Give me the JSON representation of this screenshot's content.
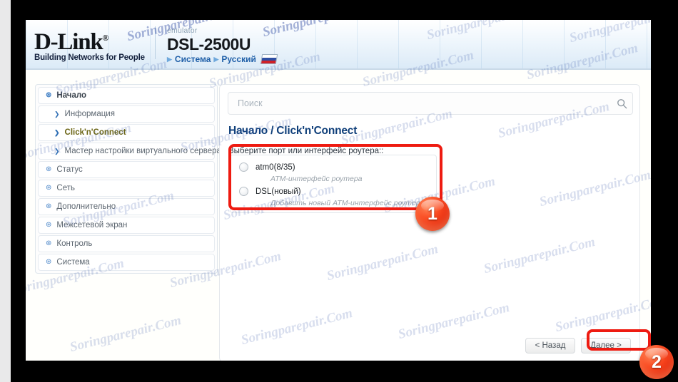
{
  "header": {
    "brand_name": "D-Link",
    "brand_reg": "®",
    "brand_tagline": "Building Networks for People",
    "emulator_label": "emulator",
    "model": "DSL-2500U",
    "link_system": "Система",
    "link_language": "Русский",
    "arrow": "▶",
    "flag": "ru-flag-icon"
  },
  "sidebar": {
    "items": [
      {
        "label": "Начало",
        "level": "top",
        "icon": "circle-collapse-icon",
        "active": false
      },
      {
        "label": "Информация",
        "level": "sub",
        "icon": "chevron-right-icon",
        "active": false
      },
      {
        "label": "Click'n'Connect",
        "level": "sub",
        "icon": "chevron-right-icon",
        "active": true
      },
      {
        "label": "Мастер настройки виртуального сервера",
        "level": "sub",
        "icon": "chevron-right-icon",
        "active": false
      },
      {
        "label": "Статус",
        "level": "top-nb",
        "icon": "circle-collapse-icon",
        "active": false
      },
      {
        "label": "Сеть",
        "level": "top-nb",
        "icon": "circle-collapse-icon",
        "active": false
      },
      {
        "label": "Дополнительно",
        "level": "top-nb",
        "icon": "circle-collapse-icon",
        "active": false
      },
      {
        "label": "Межсетевой экран",
        "level": "top-nb",
        "icon": "circle-collapse-icon",
        "active": false
      },
      {
        "label": "Контроль",
        "level": "top-nb",
        "icon": "circle-collapse-icon",
        "active": false
      },
      {
        "label": "Система",
        "level": "top-nb",
        "icon": "circle-collapse-icon",
        "active": false
      }
    ]
  },
  "main": {
    "search_placeholder": "Поиск",
    "search_value": "",
    "search_icon": "search-icon",
    "title": "Начало /  Click'n'Connect",
    "field_label": "Выберите порт или интерфейс роутера::",
    "radio_options": [
      {
        "label": "atm0(8/35)",
        "description": "ATM-интерфейс роутера",
        "selected": false
      },
      {
        "label": "DSL(новый)",
        "description": "Добавить новый ATM-интерфейс роутера",
        "selected": false
      }
    ],
    "buttons": {
      "back": "< Назад",
      "next": "Далее >"
    }
  },
  "annotations": {
    "badges": [
      {
        "id": "badge-1",
        "number": "1"
      },
      {
        "id": "badge-2",
        "number": "2"
      }
    ],
    "highlight_color": "#ee1b11"
  },
  "watermark": {
    "text": "Soringparepair.Com"
  }
}
